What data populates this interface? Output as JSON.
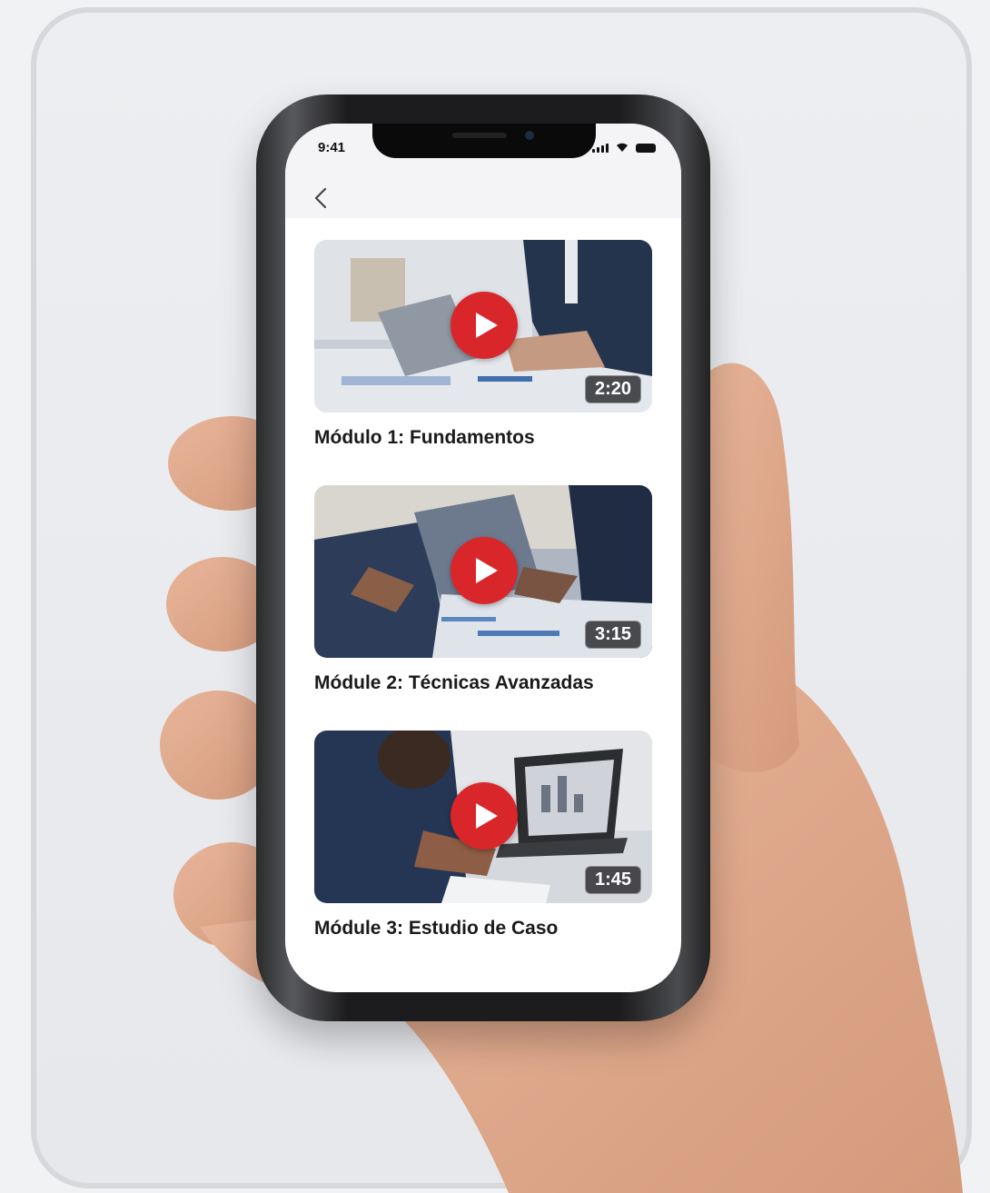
{
  "status_bar": {
    "time": "9:41",
    "icons": [
      "signal-icon",
      "wifi-icon",
      "battery-icon"
    ]
  },
  "header": {
    "back_icon": "chevron-left-icon"
  },
  "modules": [
    {
      "title": "Módulo 1: Fundamentos",
      "duration": "2:20",
      "play_icon": "play-icon"
    },
    {
      "title": "Módule 2: Técnicas Avanzadas",
      "duration": "3:15",
      "play_icon": "play-icon"
    },
    {
      "title": "Módule 3: Estudio de Caso",
      "duration": "1:45",
      "play_icon": "play-icon"
    }
  ],
  "colors": {
    "play_button": "#d9262b",
    "background": "#f1f2f4"
  }
}
